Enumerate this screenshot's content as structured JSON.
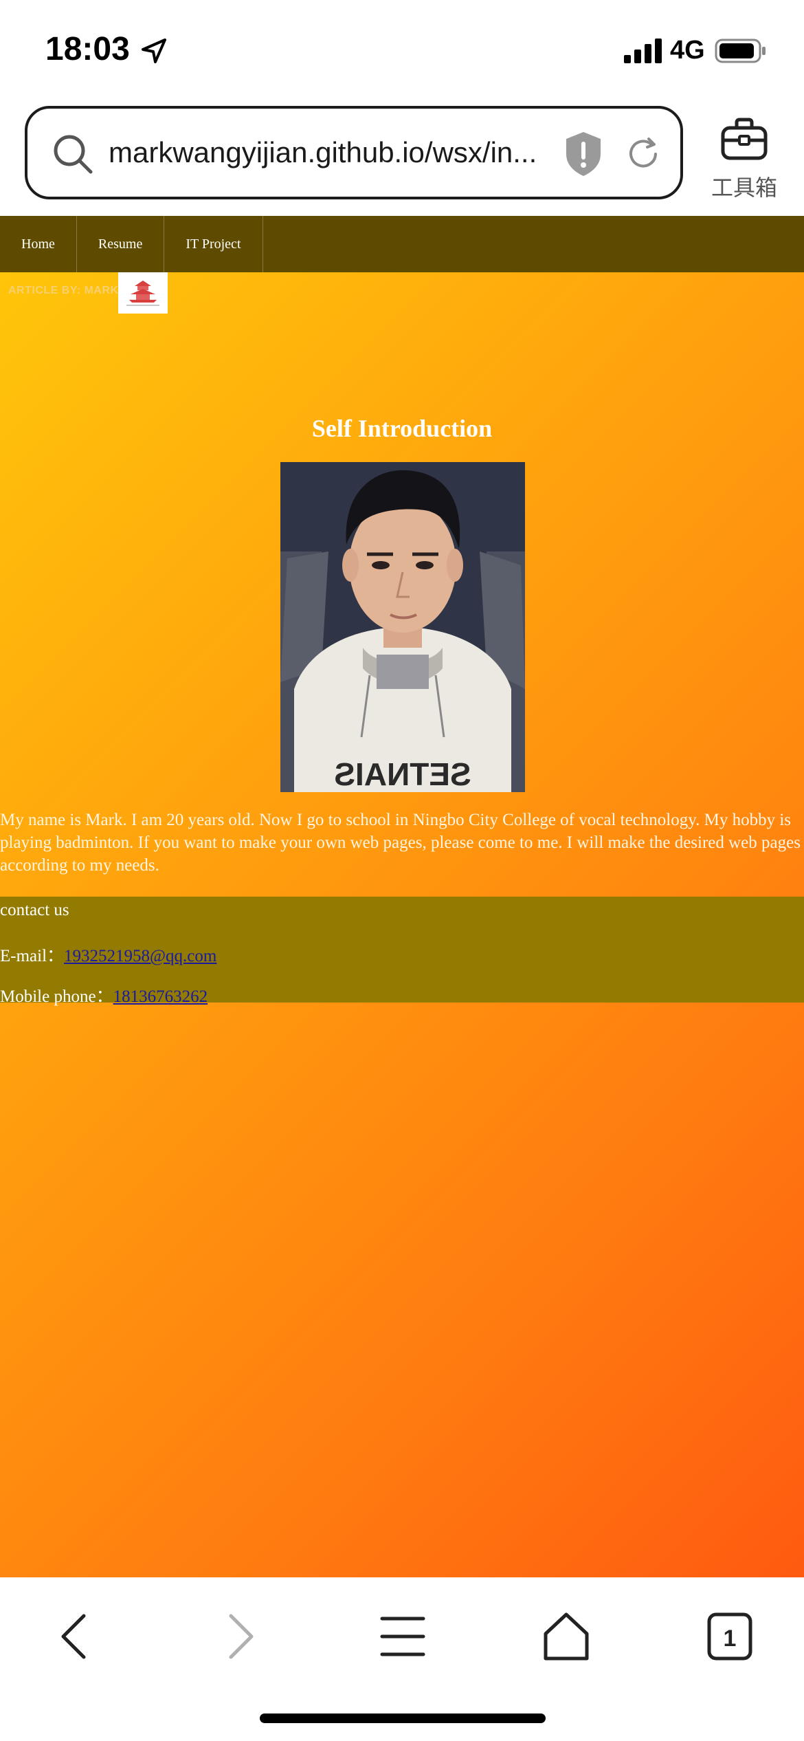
{
  "status_bar": {
    "time": "18:03",
    "network": "4G",
    "icons": [
      "location-arrow-icon",
      "signal-bars-icon",
      "battery-icon"
    ]
  },
  "browser": {
    "url": "markwangyijian.github.io/wsx/in...",
    "toolbox_label": "工具箱",
    "icons": [
      "search-icon",
      "shield-warning-icon",
      "reload-icon",
      "toolbox-icon"
    ]
  },
  "nav": {
    "items": [
      "Home",
      "Resume",
      "IT Project"
    ]
  },
  "page": {
    "byline": "ARTICLE BY: MARK",
    "title": "Self Introduction",
    "intro": "My name is Mark. I am 20 years old. Now I go to school in Ningbo City College of vocal technology. My hobby is playing badminton. If you want to make your own web pages, please come to me. I will make the desired web pages according to my needs.",
    "photo_text": "SETNAIS"
  },
  "contact": {
    "heading": "contact us",
    "email_label": "E-mail：",
    "email": "1932521958@qq.com",
    "phone_label": "Mobile phone：",
    "phone": "18136763262"
  },
  "bottom_toolbar": {
    "tab_count": "1",
    "icons": [
      "back-icon",
      "forward-icon",
      "menu-icon",
      "home-icon",
      "tabs-icon"
    ]
  },
  "colors": {
    "nav_bg": "#5e4b00",
    "contact_bg": "#937a00",
    "gradient_start": "#ffc80a",
    "gradient_end": "#ff5a10",
    "link": "#1a1aa0"
  }
}
